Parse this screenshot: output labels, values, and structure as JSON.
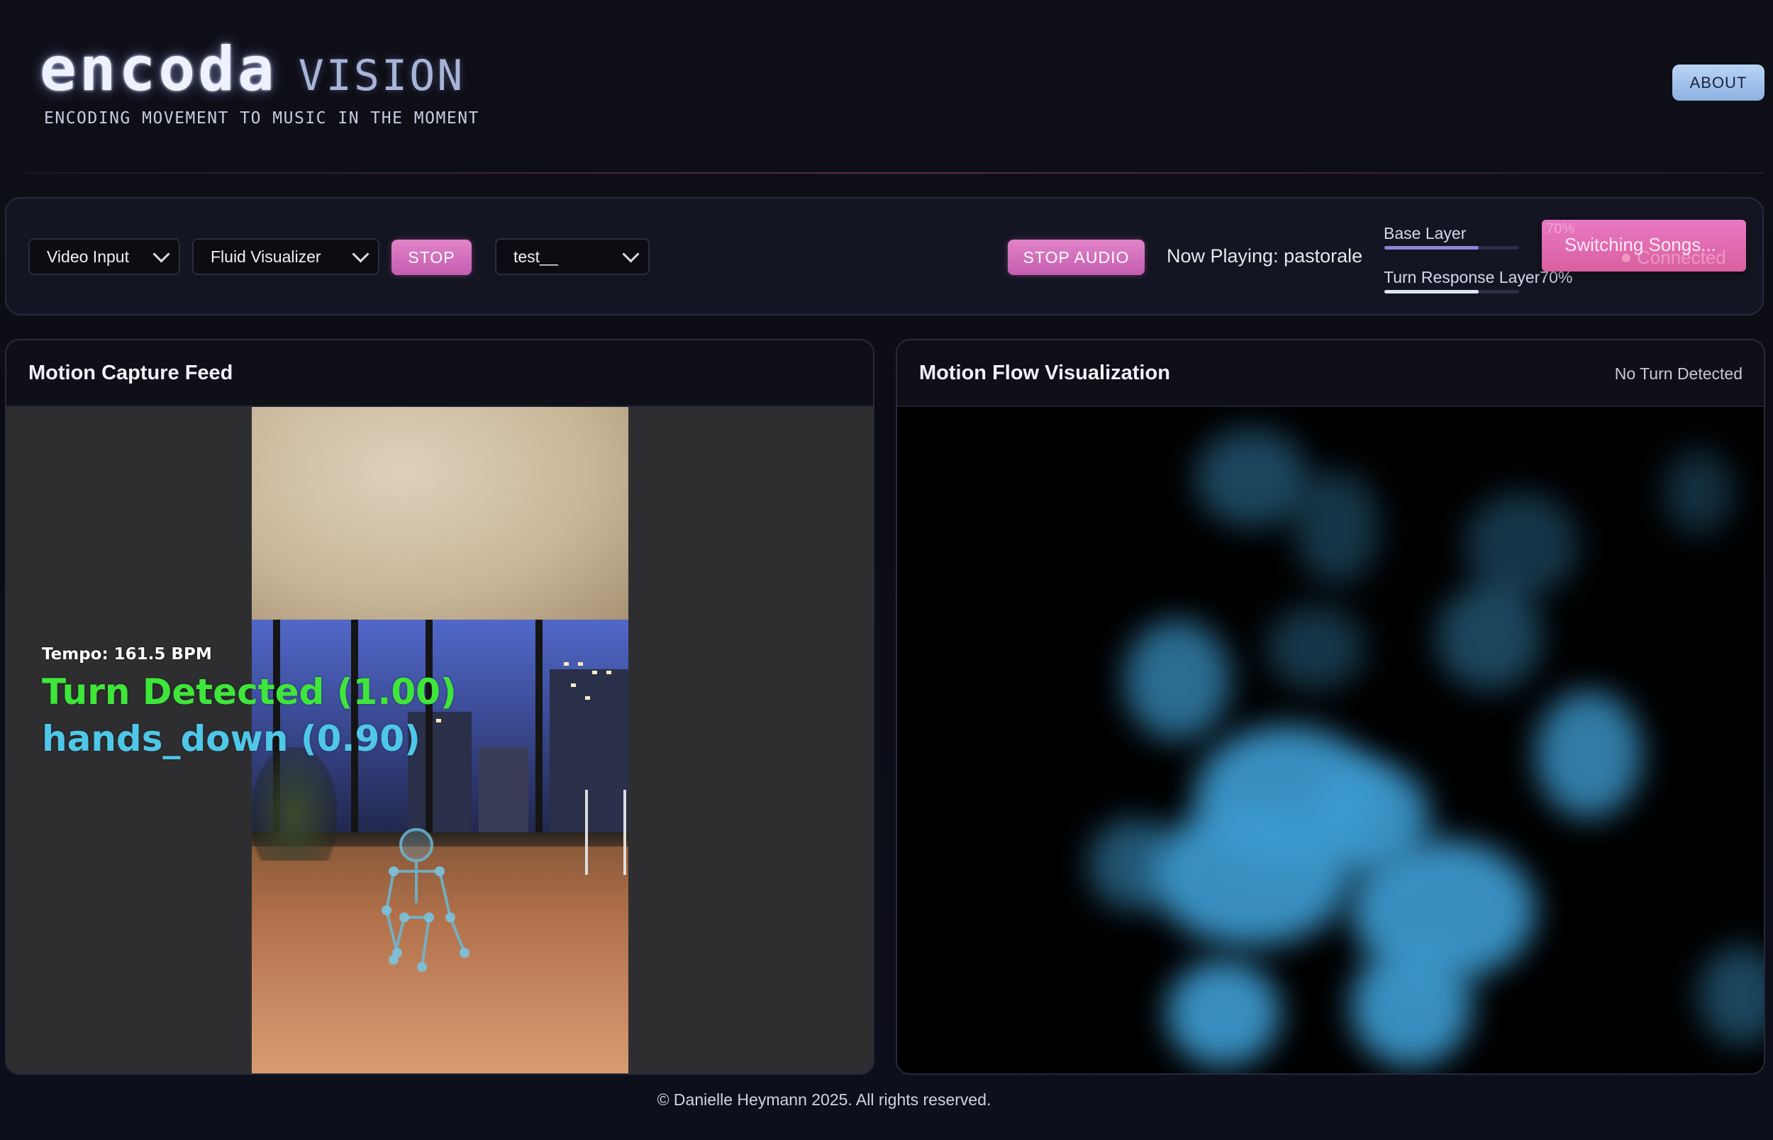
{
  "header": {
    "brand_name": "encoda",
    "brand_suffix": "VISION",
    "tagline": "ENCODING MOVEMENT TO MUSIC IN THE MOMENT",
    "about_label": "ABOUT"
  },
  "controls": {
    "input_select": "Video Input",
    "visualizer_select": "Fluid Visualizer",
    "stop_label": "STOP",
    "song_select": "test__",
    "stop_audio_label": "STOP AUDIO",
    "now_playing": "Now Playing: pastorale",
    "base_layer_label": "Base Layer",
    "base_layer_value": "70%",
    "base_layer_level": 0.7,
    "turn_layer_label": "Turn Response Layer",
    "turn_layer_value": "70%",
    "turn_layer_level": 0.7,
    "switching_label": "Switching Songs...",
    "connection_status": "Connected",
    "accent_color": "#d96fc0"
  },
  "motion_capture": {
    "title": "Motion Capture Feed",
    "tempo_text": "Tempo: 161.5 BPM",
    "turn_text": "Turn Detected (1.00)",
    "gesture_text": "hands_down (0.90)"
  },
  "motion_flow": {
    "title": "Motion Flow Visualization",
    "status": "No Turn Detected"
  },
  "footer": {
    "copyright": "© Danielle Heymann 2025. All rights reserved."
  }
}
